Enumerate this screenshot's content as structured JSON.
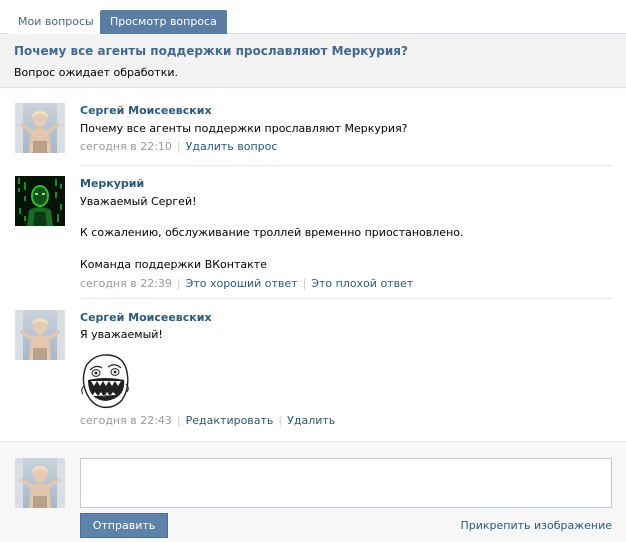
{
  "tabs": [
    {
      "label": "Мои вопросы",
      "active": false
    },
    {
      "label": "Просмотр вопроса",
      "active": true
    }
  ],
  "question": {
    "title": "Почему все агенты поддержки прославляют Меркурия?",
    "status": "Вопрос ожидает обработки."
  },
  "messages": [
    {
      "author": "Сергей Моисеевских",
      "lines": [
        "Почему все агенты поддержки прославляют Меркурия?"
      ],
      "time": "сегодня в 22:10",
      "actions": [
        "Удалить вопрос"
      ]
    },
    {
      "author": "Меркурий",
      "lines": [
        "Уважаемый Сергей!",
        "К сожалению, обслуживание троллей временно приостановлено.",
        "Команда поддержки ВКонтакте"
      ],
      "time": "сегодня в 22:39",
      "actions": [
        "Это хороший ответ",
        "Это плохой ответ"
      ]
    },
    {
      "author": "Сергей Моисеевских",
      "lines": [
        "Я уважаемый!"
      ],
      "time": "сегодня в 22:43",
      "actions": [
        "Редактировать",
        "Удалить"
      ]
    }
  ],
  "reply": {
    "value": "",
    "send_label": "Отправить",
    "attach_label": "Прикрепить изображение"
  },
  "colors": {
    "link": "#2b587a",
    "tab_active_bg": "#597da3",
    "button_bg": "#5e82a8",
    "meta": "#999999"
  },
  "icons": {
    "user_avatar": "child-photo-avatar",
    "support_avatar": "matrix-green-avatar",
    "reaction_image": "forever-alone-meme-face"
  }
}
